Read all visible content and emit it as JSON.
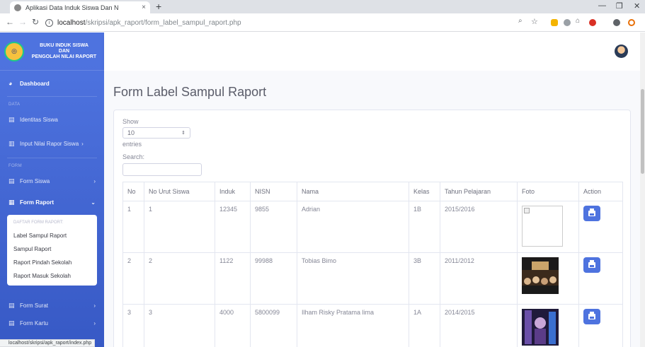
{
  "browser": {
    "tab_title": "Aplikasi Data Induk Siswa Dan N",
    "tab_close": "×",
    "new_tab": "+",
    "url_host": "localhost",
    "url_path": "/skripsi/apk_raport/form_label_sampul_raport.php",
    "status_url": "localhost/skripsi/apk_raport/index.php"
  },
  "sidebar": {
    "brand_line1": "BUKU INDUK SISWA",
    "brand_line2": "DAN",
    "brand_line3": "PENGOLAH NILAI RAPORT",
    "dashboard": "Dashboard",
    "heading_data": "DATA",
    "identitas": "Identitas Siswa",
    "input_nilai": "Input Nilai Rapor Siswa",
    "heading_form": "FORM",
    "form_siswa": "Form Siswa",
    "form_raport": "Form Raport",
    "collapse_header": "DAFTAR FORM RAPORT:",
    "sub_items": [
      "Label Sampul Raport",
      "Sampul Raport",
      "Raport Pindah Sekolah",
      "Raport Masuk Sekolah"
    ],
    "form_surat": "Form Surat",
    "form_kartu": "Form Kartu"
  },
  "page": {
    "title": "Form Label Sampul Raport"
  },
  "table_controls": {
    "show": "Show",
    "entries_value": "10",
    "entries": "entries",
    "search": "Search:"
  },
  "table": {
    "headers": [
      "No",
      "No Urut Siswa",
      "Induk",
      "NISN",
      "Nama",
      "Kelas",
      "Tahun Pelajaran",
      "Foto",
      "Action"
    ],
    "rows": [
      {
        "no": "1",
        "urut": "1",
        "induk": "12345",
        "nisn": "9855",
        "nama": "Adrian",
        "kelas": "1B",
        "tahun": "2015/2016"
      },
      {
        "no": "2",
        "urut": "2",
        "induk": "1122",
        "nisn": "99988",
        "nama": "Tobias Bimo",
        "kelas": "3B",
        "tahun": "2011/2012"
      },
      {
        "no": "3",
        "urut": "3",
        "induk": "4000",
        "nisn": "5800099",
        "nama": "Ilham Risky Pratama lima",
        "kelas": "1A",
        "tahun": "2014/2015"
      }
    ]
  }
}
